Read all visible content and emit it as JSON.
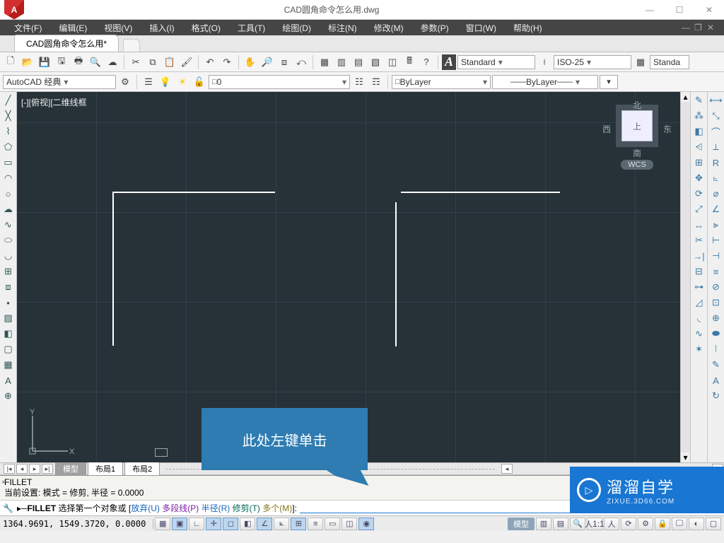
{
  "title": "CAD圆角命令怎么用.dwg",
  "app_logo": "A",
  "menus": [
    "文件(F)",
    "编辑(E)",
    "视图(V)",
    "插入(I)",
    "格式(O)",
    "工具(T)",
    "绘图(D)",
    "标注(N)",
    "修改(M)",
    "参数(P)",
    "窗口(W)",
    "帮助(H)"
  ],
  "doc_tab": "CAD圆角命令怎么用*",
  "workspace": {
    "combo": "AutoCAD 经典",
    "layer": "0"
  },
  "style_bar": {
    "textstyle": "Standard",
    "dimstyle": "ISO-25",
    "tablestyle": "Standa"
  },
  "props_bar": {
    "layer_combo": "ByLayer",
    "linetype": "ByLayer"
  },
  "viewport": {
    "label": "[-][俯视][二维线框",
    "cube_face": "上",
    "cube_n": "北",
    "cube_s": "南",
    "cube_e": "东",
    "cube_w": "西",
    "wcs": "WCS",
    "ucs_x": "X",
    "ucs_y": "Y"
  },
  "model_tabs": {
    "model": "模型",
    "layout1": "布局1",
    "layout2": "布局2"
  },
  "command": {
    "hist1": "FILLET",
    "hist2": "当前设置: 模式 = 修剪, 半径 = 0.0000",
    "cmd": "FILLET",
    "prompt_pre": " 选择第一个对象或 [",
    "opt_u": "放弃(U)",
    "opt_p": "多段线(P)",
    "opt_r": "半径(R)",
    "opt_t": "修剪(T)",
    "opt_m": "多个(M)",
    "prompt_suf": "]:"
  },
  "status": {
    "coords": "1364.9691, 1549.3720, 0.0000",
    "model_btn": "模型",
    "scale": "1:1"
  },
  "callout": "此处左键单击",
  "watermark": {
    "brand": "溜溜自学",
    "url": "ZIXUE.3D66.COM"
  }
}
